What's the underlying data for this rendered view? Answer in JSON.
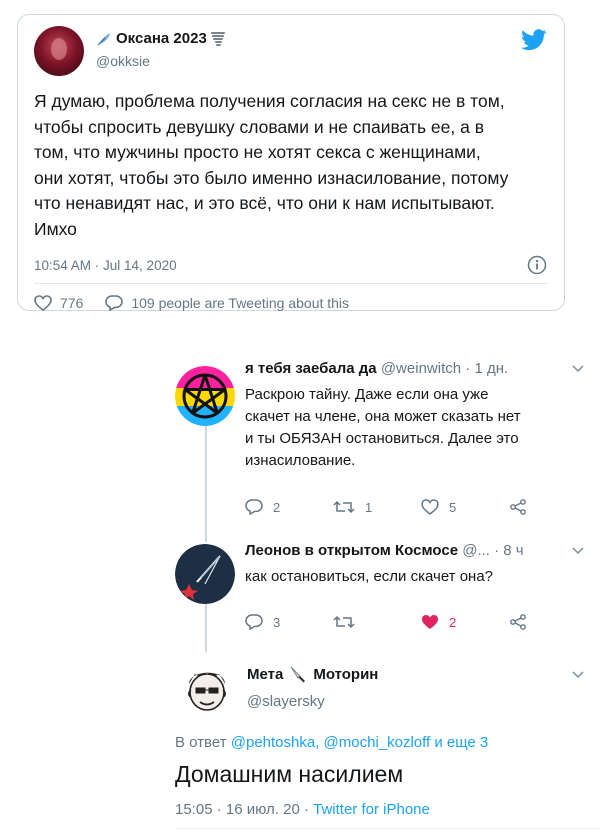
{
  "embed": {
    "author_name": "Оксана 2023",
    "author_handle": "@okksie",
    "text": "Я думаю, проблема получения согласия на секс не в том,\nчтобы спросить девушку словами и не спаивать ее, а в\nтом, что мужчины просто не хотят секса с женщинами,\nони хотят, чтобы это было именно изнасилование, потому\nчто ненавидят нас, и это всё, что они к нам испытывают.\nИмхо",
    "timestamp": "10:54 AM · Jul 14, 2020",
    "likes": "776",
    "tweeting_text": "109 people are Tweeting about this",
    "icons": [
      "feather-icon",
      "tornado-icon",
      "twitter-bird-icon",
      "info-icon",
      "heart-icon",
      "reply-icon"
    ],
    "brand_color": "#1da1f2"
  },
  "thread": [
    {
      "name": "я тебя заебала да",
      "handle": "@weinwitch",
      "time": "1 дн.",
      "text": "Раскрою тайну. Даже если она уже\nскачет на члене, она может сказать нет\nи ты ОБЯЗАН остановиться. Далее это\nизнасилование.",
      "replies": "2",
      "retweets": "1",
      "likes": "5",
      "liked": false
    },
    {
      "name": "Леонов в открытом Космосе",
      "handle": "@...",
      "time": "8 ч",
      "text": "как остановиться, если скачет она?",
      "replies": "3",
      "retweets": "",
      "likes": "2",
      "liked": true
    }
  ],
  "focused": {
    "name_first": "Мета",
    "name_second": "Моторин",
    "handle": "@slayersky",
    "reply_prefix": "В ответ",
    "reply_mentions": "@pehtoshka, @mochi_kozloff и еще 3",
    "text": "Домашним насилием",
    "stamp_time": "15:05 · 16 июл. 20 ·",
    "stamp_source": "Twitter for iPhone"
  },
  "colors": {
    "like_active": "#e0245e",
    "muted": "#657786",
    "link": "#1da1f2"
  }
}
